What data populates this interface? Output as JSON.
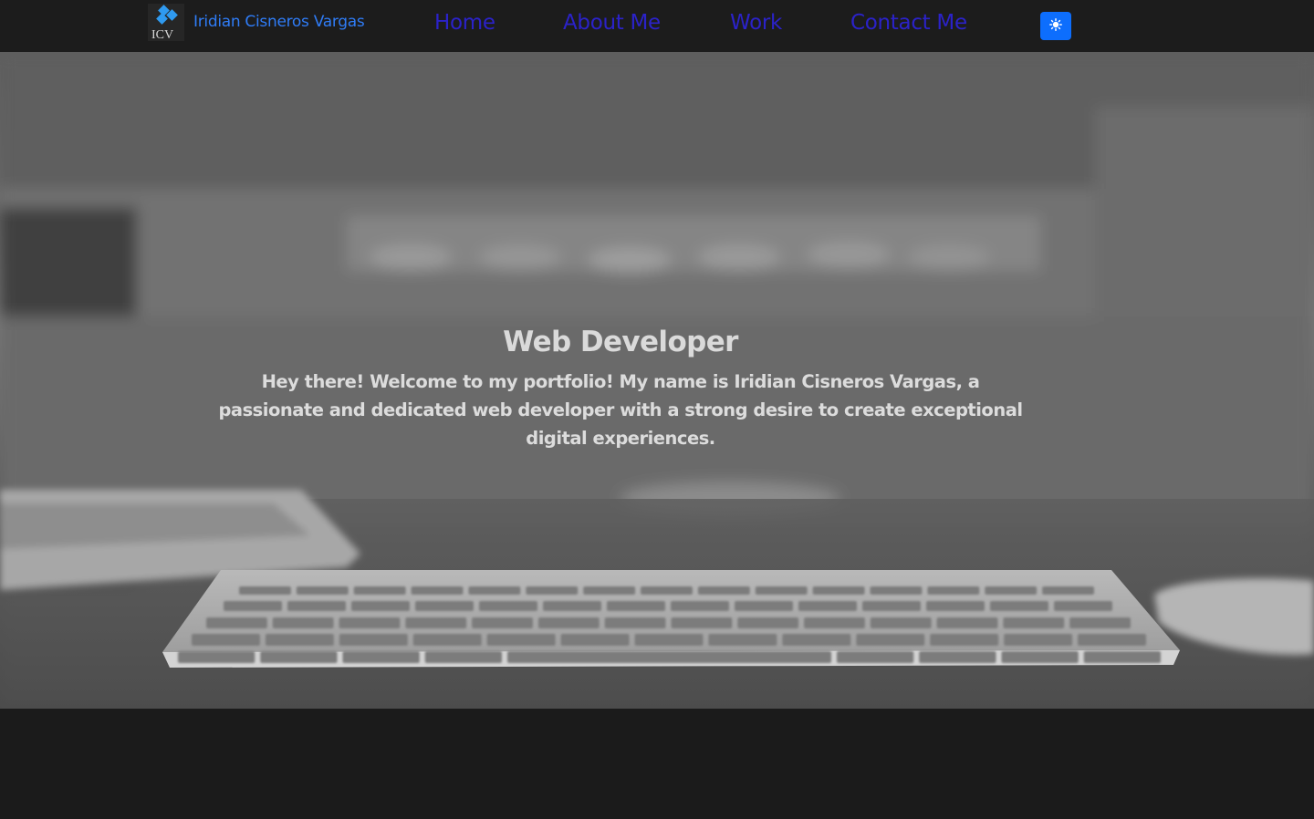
{
  "navbar": {
    "brand_logo_text": "ICV",
    "brand_name": "Iridian Cisneros Vargas",
    "links": [
      {
        "label": "Home"
      },
      {
        "label": "About Me"
      },
      {
        "label": "Work"
      },
      {
        "label": "Contact Me"
      }
    ],
    "theme_toggle_icon": "sun-icon",
    "link_color": "#2b22c9",
    "brand_color": "#2f7cf6",
    "toggle_color": "#0d6efd"
  },
  "hero": {
    "title": "Web Developer",
    "text": "Hey there! Welcome to my portfolio! My name is Iridian Cisneros Vargas, a passionate and dedicated web developer with a strong desire to create exceptional digital experiences.",
    "background_image": "desk-keyboard-photo"
  }
}
